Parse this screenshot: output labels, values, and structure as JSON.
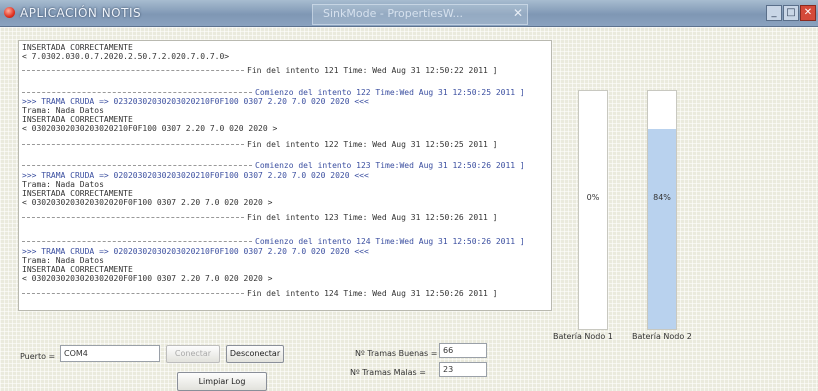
{
  "window": {
    "title": "APLICACIÓN NOTIS",
    "foreground_title": "SinkMode - PropertiesW...",
    "close_glyph": "✕",
    "minimize_glyph": "_",
    "maximize_glyph": "□"
  },
  "log": {
    "lines": [
      "INSERTADA CORRECTAMENTE",
      "< 7.0302.030.0.7.2020.2.50.7.2.020.7.0.7.0>",
      "Fin del intento 121 Time: Wed Aug 31 12:50:22 2011 ]",
      "Comienzo del intento 122 Time:Wed Aug 31 12:50:25 2011 ]",
      ">>> TRAMA CRUDA => 02320302030203020210F0F100 0307 2.20 7.0 020 2020 <<<",
      "Trama: Nada Datos",
      "INSERTADA CORRECTAMENTE",
      "< 03020302030203020210F0F100 0307 2.20 7.0 020 2020 >",
      "Fin del intento 122 Time: Wed Aug 31 12:50:25 2011 ]",
      "Comienzo del intento 123 Time:Wed Aug 31 12:50:26 2011 ]",
      ">>> TRAMA CRUDA => 02020302030203020210F0F100 0307 2.20 7.0 020 2020 <<<",
      "Trama: Nada Datos",
      "INSERTADA CORRECTAMENTE",
      "< 0302030203020302020F0F100 0307 2.20 7.0 020 2020 >",
      "Fin del intento 123 Time: Wed Aug 31 12:50:26 2011 ]",
      "Comienzo del intento 124 Time:Wed Aug 31 12:50:26 2011 ]",
      ">>> TRAMA CRUDA => 02020302030203020210F0F100 0307 2.20 7.0 020 2020 <<<",
      "Trama: Nada Datos",
      "INSERTADA CORRECTAMENTE",
      "< 0302030203020302020F0F100 0307 2.20 7.0 020 2020 >",
      "Fin del intento 124 Time: Wed Aug 31 12:50:26 2011 ]"
    ]
  },
  "gauges": [
    {
      "label": "Batería Nodo 1",
      "percent_text": "0%",
      "fill_fraction": 0.0
    },
    {
      "label": "Batería Nodo 2",
      "percent_text": "84%",
      "fill_fraction": 0.84
    }
  ],
  "controls": {
    "port_label": "Puerto =",
    "port_value": "COM4",
    "connect_label": "Conectar",
    "disconnect_label": "Desconectar",
    "log_button_label": "Limpiar Log",
    "good_frames_label": "Nº Tramas Buenas =",
    "good_frames_value": "66",
    "bad_frames_label": "Nº Tramas Malas =",
    "bad_frames_value": "23"
  }
}
